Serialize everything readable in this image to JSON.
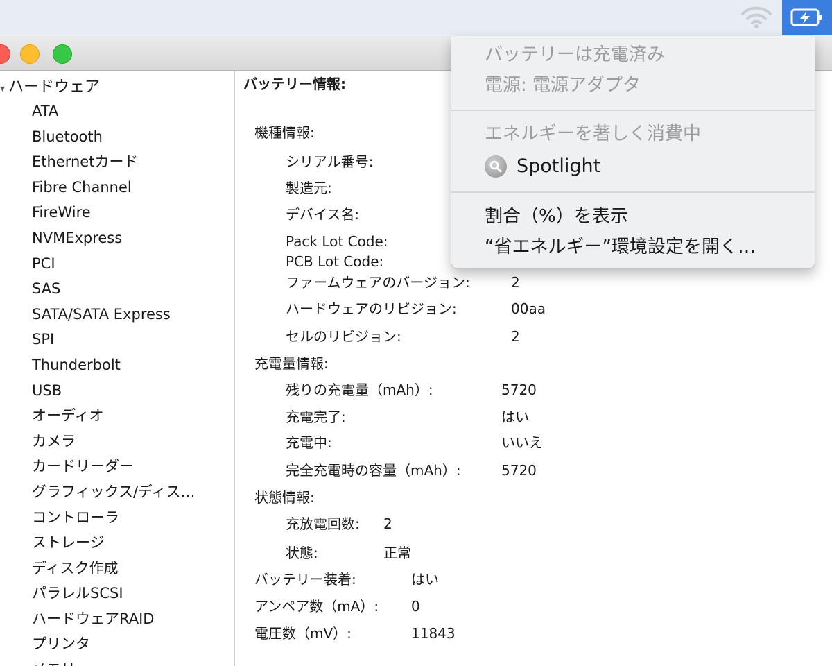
{
  "menubar": {
    "wifi_icon": "wifi-icon",
    "battery_icon": "battery-charging-icon",
    "accent": "#3a7ee0"
  },
  "window": {
    "controls": [
      "close",
      "minimize",
      "zoom"
    ]
  },
  "sidebar": {
    "header": "ハードウェア",
    "items": [
      "ATA",
      "Bluetooth",
      "Ethernetカード",
      "Fibre Channel",
      "FireWire",
      "NVMExpress",
      "PCI",
      "SAS",
      "SATA/SATA Express",
      "SPI",
      "Thunderbolt",
      "USB",
      "オーディオ",
      "カメラ",
      "カードリーダー",
      "グラフィックス/ディス…",
      "コントローラ",
      "ストレージ",
      "ディスク作成",
      "パラレルSCSI",
      "ハードウェアRAID",
      "プリンタ",
      "メモリ"
    ]
  },
  "content": {
    "title": "バッテリー情報:",
    "model_info": {
      "heading": "機種情報:",
      "serial_label": "シリアル番号:",
      "manufacturer_label": "製造元:",
      "device_name_label": "デバイス名:",
      "pack_lot_label": "Pack Lot Code:",
      "pcb_lot_label": "PCB Lot Code:",
      "firmware_label": "ファームウェアのバージョン:",
      "firmware_value": "2",
      "hardware_rev_label": "ハードウェアのリビジョン:",
      "hardware_rev_value": "00aa",
      "cell_rev_label": "セルのリビジョン:",
      "cell_rev_value": "2"
    },
    "charge_info": {
      "heading": "充電量情報:",
      "remaining_label": "残りの充電量（mAh）:",
      "remaining_value": "5720",
      "fully_charged_label": "充電完了:",
      "fully_charged_value": "はい",
      "charging_label": "充電中:",
      "charging_value": "いいえ",
      "full_capacity_label": "完全充電時の容量（mAh）:",
      "full_capacity_value": "5720"
    },
    "health_info": {
      "heading": "状態情報:",
      "cycle_label": "充放電回数:",
      "cycle_value": "2",
      "condition_label": "状態:",
      "condition_value": "正常"
    },
    "installed_label": "バッテリー装着:",
    "installed_value": "はい",
    "amperage_label": "アンペア数（mA）:",
    "amperage_value": "0",
    "voltage_label": "電圧数（mV）:",
    "voltage_value": "11843"
  },
  "battery_menu": {
    "status": "バッテリーは充電済み",
    "power_source": "電源: 電源アダプタ",
    "energy_heading": "エネルギーを著しく消費中",
    "app_name": "Spotlight",
    "show_percentage": "割合（%）を表示",
    "open_energy_prefs": "“省エネルギー”環境設定を開く…"
  }
}
